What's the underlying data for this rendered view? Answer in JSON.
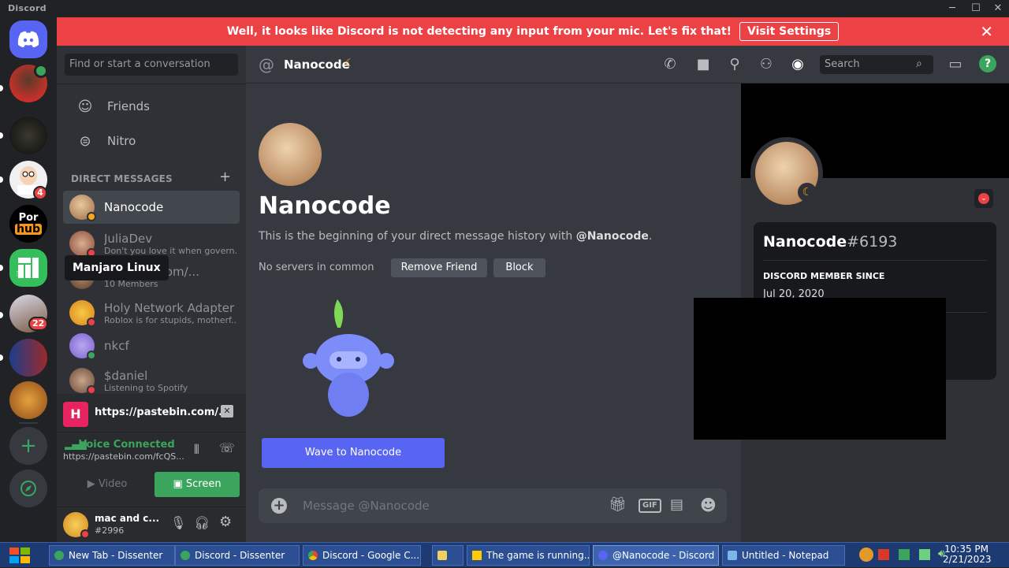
{
  "window": {
    "title": "Discord"
  },
  "rail": {
    "badge_peter": "4",
    "badge_hat": "22",
    "tooltip": "Manjaro Linux",
    "porn_label_1": "Por",
    "porn_label_2": "hub"
  },
  "sidebar": {
    "search_placeholder": "Find or start a conversation",
    "friends_label": "Friends",
    "nitro_label": "Nitro",
    "dm_header": "DIRECT MESSAGES",
    "dms": [
      {
        "name": "Nanocode",
        "sub": ""
      },
      {
        "name": "JuliaDev",
        "sub": "Don't you love it when govern..."
      },
      {
        "name": "pastebin.com/...",
        "sub": "10 Members"
      },
      {
        "name": "Holy Network Adapter",
        "sub": "Roblox is for stupids, motherf..."
      },
      {
        "name": "nkcf",
        "sub": ""
      },
      {
        "name": "$daniel",
        "sub": "Listening to Spotify"
      }
    ],
    "stream_url": "https://pastebin.com/...",
    "voice_status": "Voice Connected",
    "voice_channel": "https://pastebin.com/fcQS...",
    "video_label": "Video",
    "screen_label": "Screen",
    "user_name": "mac and c...",
    "user_tag": "#2996"
  },
  "banner": {
    "message": "Well, it looks like Discord is not detecting any input from your mic. Let's fix that!",
    "action": "Visit Settings"
  },
  "header": {
    "channel_name": "Nanocode",
    "search_placeholder": "Search"
  },
  "chat": {
    "title": "Nanocode",
    "intro_prefix": "This is the beginning of your direct message history with ",
    "intro_user": "@Nanocode",
    "intro_suffix": ".",
    "servers_common": "No servers in common",
    "remove_friend": "Remove Friend",
    "block": "Block",
    "wave": "Wave to Nanocode",
    "composer_placeholder": "Message @Nanocode",
    "gif_label": "GIF"
  },
  "profile": {
    "username": "Nanocode",
    "discriminator": "#6193",
    "member_since_label": "DISCORD MEMBER SINCE",
    "member_since_date": "Jul 20, 2020"
  },
  "taskbar": {
    "items": [
      "New Tab - Dissenter",
      "Discord - Dissenter",
      "Discord - Google C...",
      "",
      "The game is running...",
      "@Nanocode - Discord",
      "Untitled - Notepad"
    ],
    "time": "10:35 PM",
    "date": "2/21/2023"
  },
  "colors": {
    "blurple": "#5865f2",
    "danger": "#ed4245",
    "green": "#3ba55d",
    "idle": "#faa61a"
  }
}
